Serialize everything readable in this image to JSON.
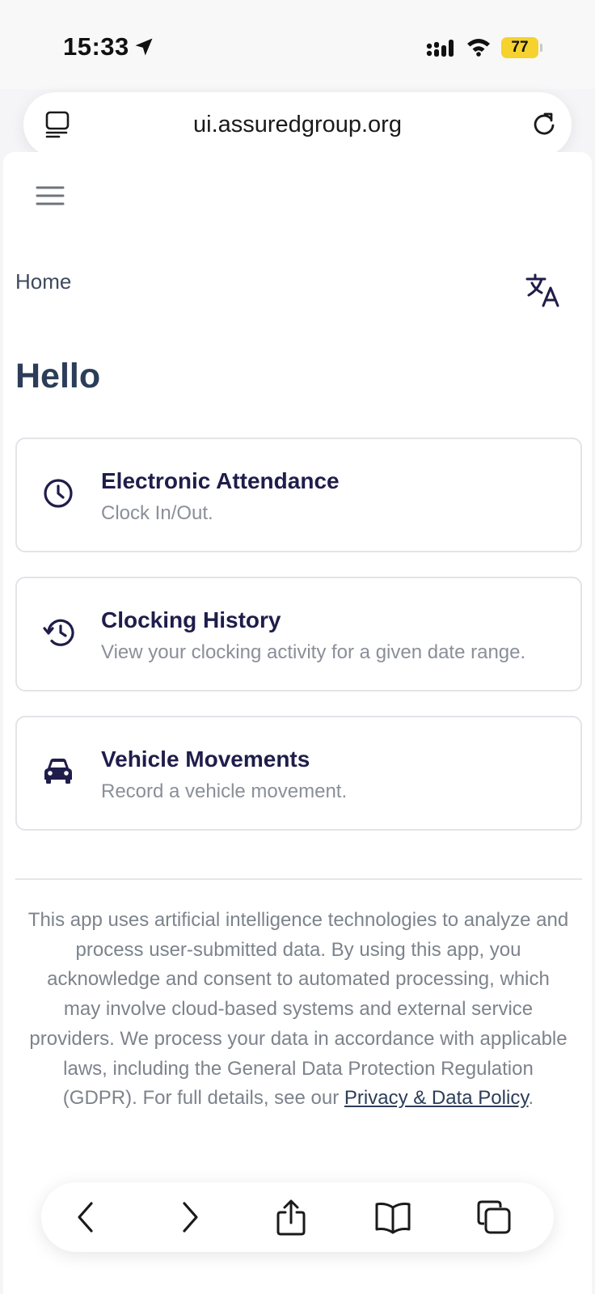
{
  "status_bar": {
    "time": "15:33",
    "battery": "77",
    "icons": [
      "location-arrow-icon",
      "signal-icon",
      "wifi-icon",
      "battery-icon"
    ]
  },
  "browser": {
    "url": "ui.assuredgroup.org",
    "icons": [
      "tabs-overview-icon",
      "reload-icon"
    ]
  },
  "header": {
    "breadcrumb": "Home",
    "icons": [
      "hamburger-menu-icon",
      "translate-icon"
    ]
  },
  "main": {
    "greeting": "Hello",
    "cards": [
      {
        "title": "Electronic Attendance",
        "description": "Clock In/Out.",
        "icon": "clock-icon"
      },
      {
        "title": "Clocking History",
        "description": "View your clocking activity for a given date range.",
        "icon": "history-icon"
      },
      {
        "title": "Vehicle Movements",
        "description": "Record a vehicle movement.",
        "icon": "car-icon"
      }
    ]
  },
  "footer": {
    "disclaimer": "This app uses artificial intelligence technologies to analyze and process user-submitted data. By using this app, you acknowledge and consent to automated processing, which may involve cloud-based systems and external service providers. We process your data in accordance with applicable laws, including the General Data Protection Regulation (GDPR). For full details, see our ",
    "policy_link": "Privacy & Data Policy",
    "end": "."
  },
  "toolbar": {
    "icons": [
      "back-icon",
      "forward-icon",
      "share-icon",
      "bookmarks-icon",
      "tabs-icon"
    ]
  },
  "colors": {
    "heading": "#2b3d58",
    "card_title": "#1f1d4a",
    "muted_text": "#8a8f98",
    "battery": "#f5d22d"
  }
}
